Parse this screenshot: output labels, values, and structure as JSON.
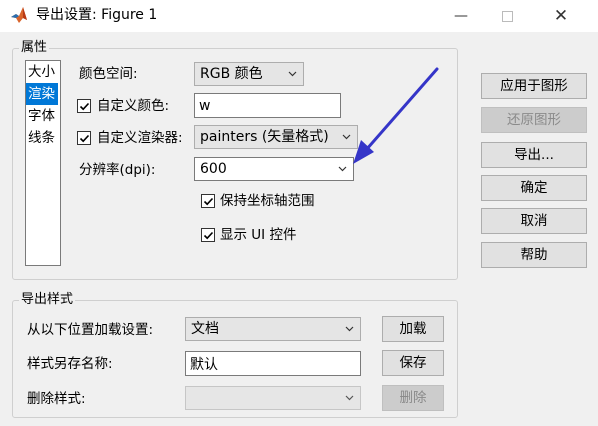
{
  "window": {
    "title": "导出设置: Figure 1",
    "minimize_icon": "minimize-icon",
    "maximize_icon": "maximize-icon",
    "close_icon": "close-icon"
  },
  "properties": {
    "legend": "属性",
    "list_items": [
      {
        "label": "大小",
        "selected": false
      },
      {
        "label": "渲染",
        "selected": true
      },
      {
        "label": "字体",
        "selected": false
      },
      {
        "label": "线条",
        "selected": false
      }
    ],
    "colorspace": {
      "label": "颜色空间:",
      "value": "RGB 颜色"
    },
    "custom_color": {
      "label": "自定义颜色:",
      "checked": true,
      "value": "w"
    },
    "custom_renderer": {
      "label": "自定义渲染器:",
      "checked": true,
      "value": "painters (矢量格式)"
    },
    "resolution": {
      "label": "分辨率(dpi):",
      "value": "600"
    },
    "keep_axes_limits": {
      "label": "保持坐标轴范围",
      "checked": true
    },
    "show_ui": {
      "label": "显示 UI 控件",
      "checked": true
    }
  },
  "side_buttons": {
    "apply": "应用于图形",
    "revert": "还原图形",
    "export": "导出...",
    "ok": "确定",
    "cancel": "取消",
    "help": "帮助"
  },
  "export_styles": {
    "legend": "导出样式",
    "load_label": "从以下位置加载设置:",
    "load_value": "文档",
    "load_button": "加载",
    "saveas_label": "样式另存名称:",
    "saveas_value": "默认",
    "save_button": "保存",
    "delete_label": "删除样式:",
    "delete_value": "",
    "delete_button": "删除"
  },
  "colors": {
    "selection": "#0078d7",
    "annotation_arrow": "#3535c8",
    "dialog_bg": "#f0f0f0"
  }
}
